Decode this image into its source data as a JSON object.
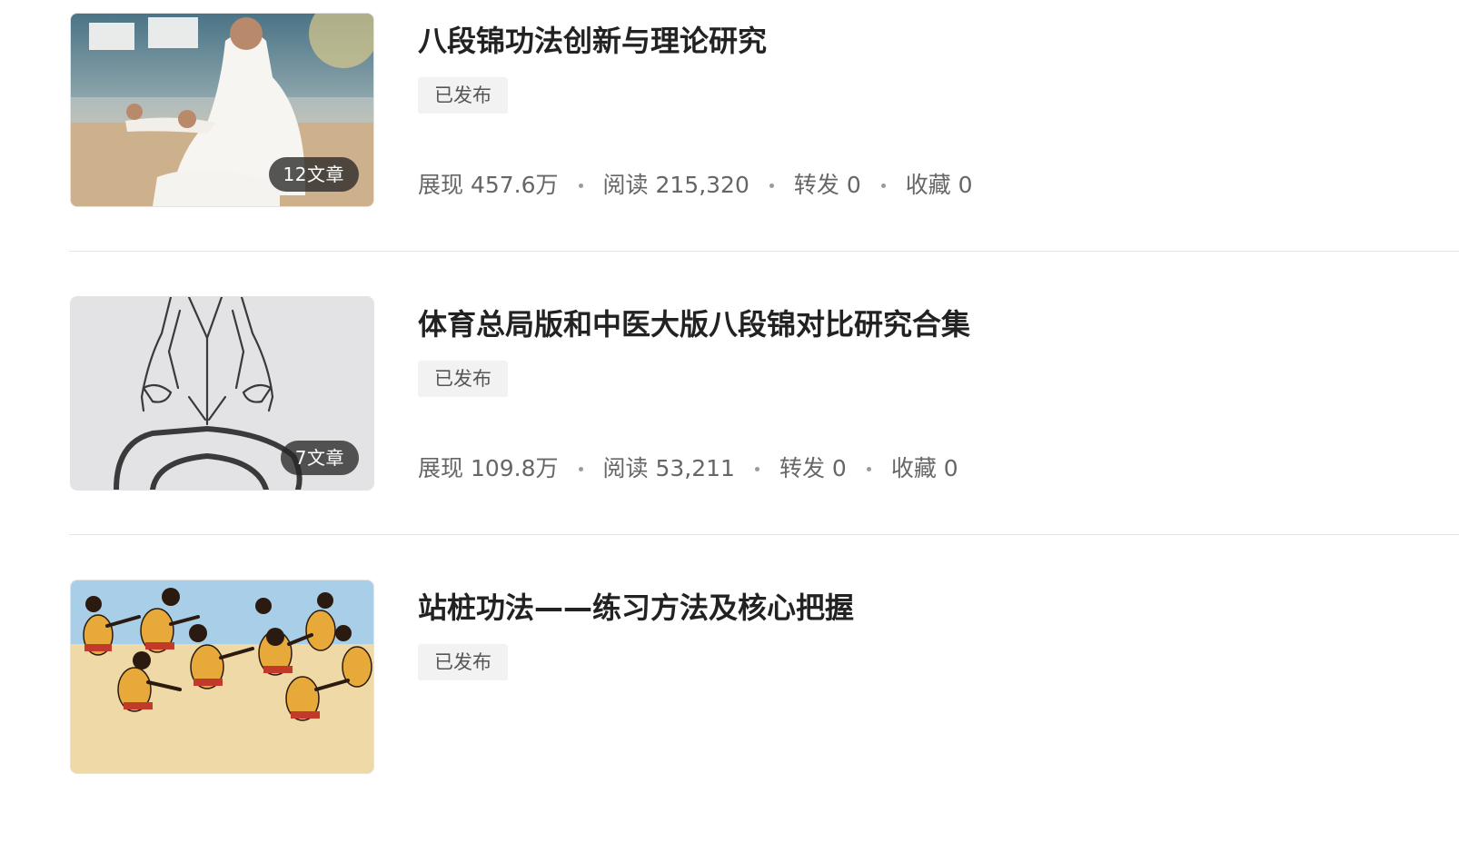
{
  "colors": {
    "text_primary": "#222222",
    "text_secondary": "#666666",
    "badge_bg": "#f2f2f2",
    "divider": "#e5e5e5",
    "count_badge_bg": "#282828"
  },
  "items": [
    {
      "title": "八段锦功法创新与理论研究",
      "status": "已发布",
      "article_count": "12文章",
      "thumbnail_icon": "tai-chi-photo-thumbnail",
      "stats": {
        "impressions": "展现 457.6万",
        "reads": "阅读 215,320",
        "shares": "转发 0",
        "favorites": "收藏 0"
      }
    },
    {
      "title": "体育总局版和中医大版八段锦对比研究合集",
      "status": "已发布",
      "article_count": "7文章",
      "thumbnail_icon": "line-drawing-thumbnail",
      "stats": {
        "impressions": "展现 109.8万",
        "reads": "阅读 53,211",
        "shares": "转发 0",
        "favorites": "收藏 0"
      }
    },
    {
      "title": "站桩功法——练习方法及核心把握",
      "status": "已发布",
      "thumbnail_icon": "illustration-dancers-thumbnail"
    }
  ]
}
